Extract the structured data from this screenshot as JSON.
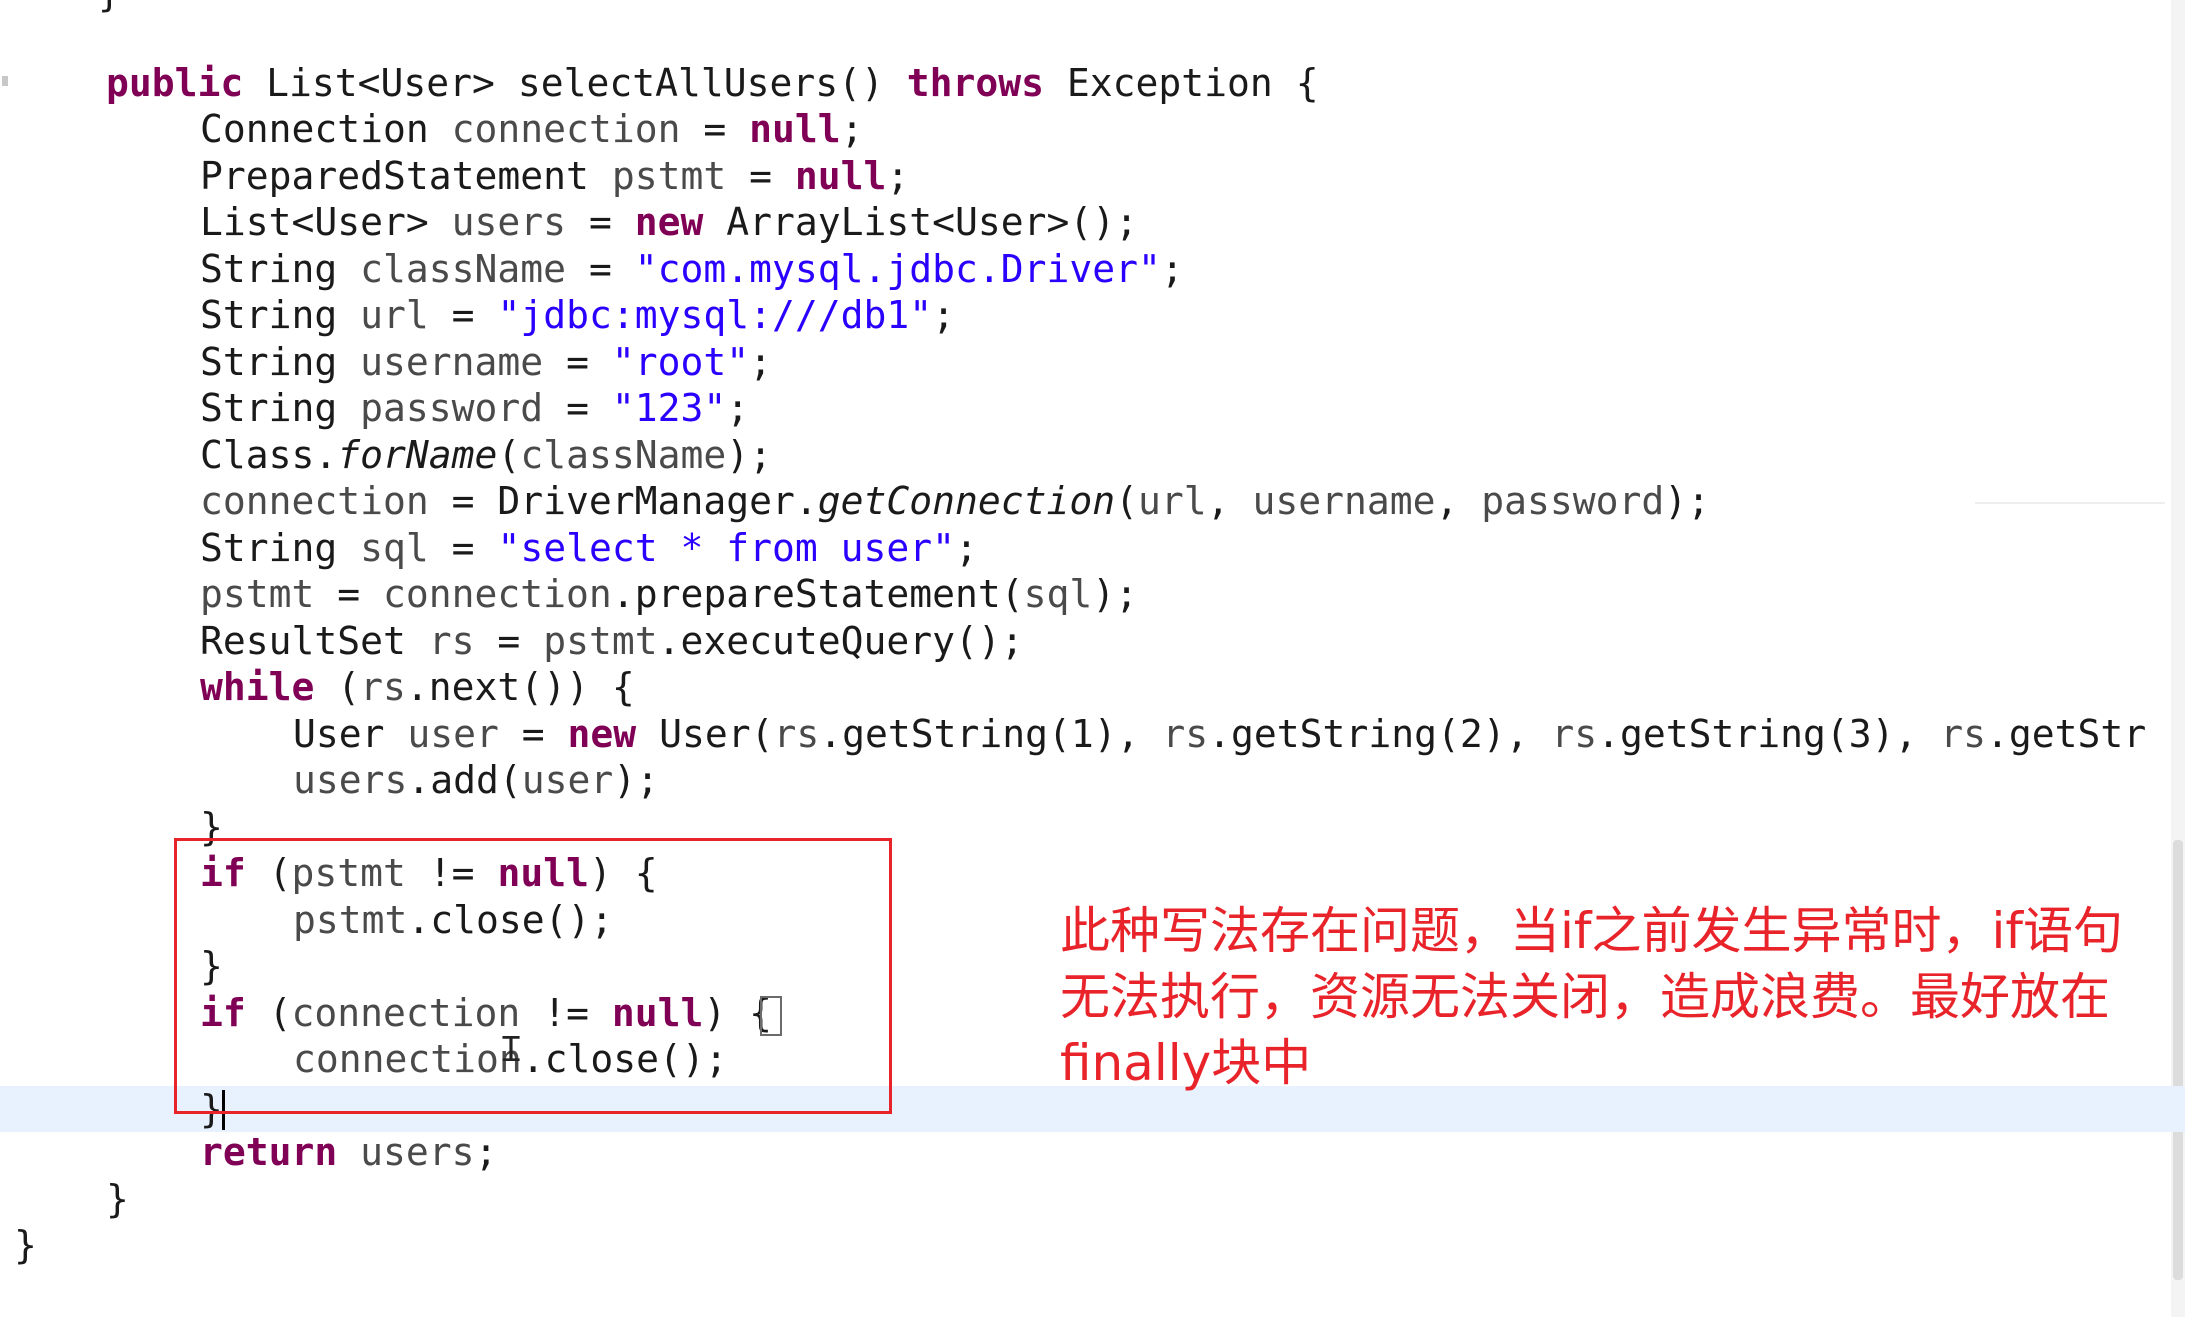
{
  "editor": {
    "lines": {
      "l0": "}",
      "l1a": "public",
      "l1b": " List<User> selectAllUsers() ",
      "l1c": "throws",
      "l1d": " Exception {",
      "l2a": "Connection ",
      "l2b": "connection",
      "l2c": " = ",
      "l2d": "null",
      "l2e": ";",
      "l3a": "PreparedStatement ",
      "l3b": "pstmt",
      "l3c": " = ",
      "l3d": "null",
      "l3e": ";",
      "l4a": "List<User> ",
      "l4b": "users",
      "l4c": " = ",
      "l4d": "new",
      "l4e": " ArrayList<User>();",
      "l5a": "String ",
      "l5b": "className",
      "l5c": " = ",
      "l5d": "\"com.mysql.jdbc.Driver\"",
      "l5e": ";",
      "l6a": "String ",
      "l6b": "url",
      "l6c": " = ",
      "l6d": "\"jdbc:mysql:///db1\"",
      "l6e": ";",
      "l7a": "String ",
      "l7b": "username",
      "l7c": " = ",
      "l7d": "\"root\"",
      "l7e": ";",
      "l8a": "String ",
      "l8b": "password",
      "l8c": " = ",
      "l8d": "\"123\"",
      "l8e": ";",
      "l9a": "Class.",
      "l9b": "forName",
      "l9c": "(",
      "l9d": "className",
      "l9e": ");",
      "l10a": "connection",
      "l10b": " = DriverManager.",
      "l10c": "getConnection",
      "l10d": "(",
      "l10e": "url",
      "l10f": ", ",
      "l10g": "username",
      "l10h": ", ",
      "l10i": "password",
      "l10j": ");",
      "l11a": "String ",
      "l11b": "sql",
      "l11c": " = ",
      "l11d": "\"select * from user\"",
      "l11e": ";",
      "l12a": "pstmt",
      "l12b": " = ",
      "l12c": "connection",
      "l12d": ".prepareStatement(",
      "l12e": "sql",
      "l12f": ");",
      "l13a": "ResultSet ",
      "l13b": "rs",
      "l13c": " = ",
      "l13d": "pstmt",
      "l13e": ".executeQuery();",
      "l14a": "while",
      "l14b": " (",
      "l14c": "rs",
      "l14d": ".next()) {",
      "l15a": "User ",
      "l15b": "user",
      "l15c": " = ",
      "l15d": "new",
      "l15e": " User(",
      "l15f": "rs",
      "l15g": ".getString(1), ",
      "l15h": "rs",
      "l15i": ".getString(2), ",
      "l15j": "rs",
      "l15k": ".getString(3), ",
      "l15l": "rs",
      "l15m": ".getStr",
      "l16a": "users",
      "l16b": ".add(",
      "l16c": "user",
      "l16d": ");",
      "l17": "}",
      "l18a": "if",
      "l18b": " (",
      "l18c": "pstmt",
      "l18d": " != ",
      "l18e": "null",
      "l18f": ") {",
      "l19a": "pstmt",
      "l19b": ".close();",
      "l20": "}",
      "l21a": "if",
      "l21b": " (",
      "l21c": "connection",
      "l21d": " != ",
      "l21e": "null",
      "l21f": ") {",
      "l22a": "connection",
      "l22b": ".close();",
      "l23": "}",
      "l24a": "return",
      "l24b": " ",
      "l24c": "users",
      "l24d": ";",
      "l25": "}",
      "l26": "}"
    }
  },
  "annotation": {
    "line1": "此种写法存在问题，当if之前发生异常时，if语句",
    "line2": "无法执行，资源无法关闭，造成浪费。最好放在",
    "line3": "finally块中"
  },
  "colors": {
    "keyword": "#7f0055",
    "string": "#2a00ff",
    "annotation": "#e8232a",
    "current_line": "#e8f2fe"
  },
  "icons": {
    "cursor": "text-cursor-icon"
  }
}
